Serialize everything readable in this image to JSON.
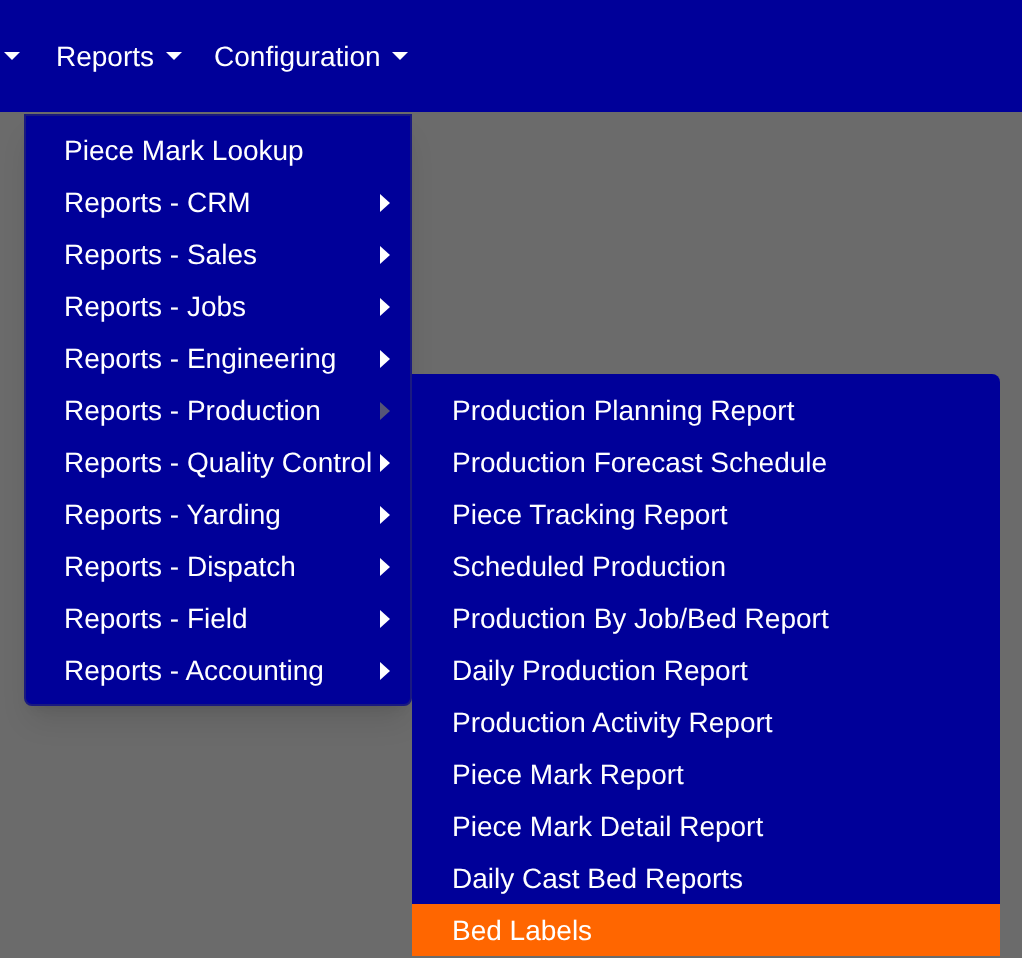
{
  "navbar": {
    "items": [
      {
        "label": "Reports"
      },
      {
        "label": "Configuration"
      }
    ]
  },
  "reports_menu": {
    "items": [
      {
        "label": "Piece Mark Lookup",
        "kind": "link"
      },
      {
        "label": "Reports - CRM",
        "kind": "submenu",
        "expanded": false
      },
      {
        "label": "Reports - Sales",
        "kind": "submenu",
        "expanded": false
      },
      {
        "label": "Reports - Jobs",
        "kind": "submenu",
        "expanded": false
      },
      {
        "label": "Reports - Engineering",
        "kind": "submenu",
        "expanded": false
      },
      {
        "label": "Reports - Production",
        "kind": "submenu",
        "expanded": true
      },
      {
        "label": "Reports - Quality Control",
        "kind": "submenu",
        "expanded": false
      },
      {
        "label": "Reports - Yarding",
        "kind": "submenu",
        "expanded": false
      },
      {
        "label": "Reports - Dispatch",
        "kind": "submenu",
        "expanded": false
      },
      {
        "label": "Reports - Field",
        "kind": "submenu",
        "expanded": false
      },
      {
        "label": "Reports - Accounting",
        "kind": "submenu",
        "expanded": false
      }
    ]
  },
  "production_submenu": {
    "items": [
      {
        "label": "Production Planning Report",
        "selected": false
      },
      {
        "label": "Production Forecast Schedule",
        "selected": false
      },
      {
        "label": "Piece Tracking Report",
        "selected": false
      },
      {
        "label": "Scheduled Production",
        "selected": false
      },
      {
        "label": "Production By Job/Bed Report",
        "selected": false
      },
      {
        "label": "Daily Production Report",
        "selected": false
      },
      {
        "label": "Production Activity Report",
        "selected": false
      },
      {
        "label": "Piece Mark Report",
        "selected": false
      },
      {
        "label": "Piece Mark Detail Report",
        "selected": false
      },
      {
        "label": "Daily Cast Bed Reports",
        "selected": false
      },
      {
        "label": "Bed Labels",
        "selected": true
      }
    ]
  }
}
